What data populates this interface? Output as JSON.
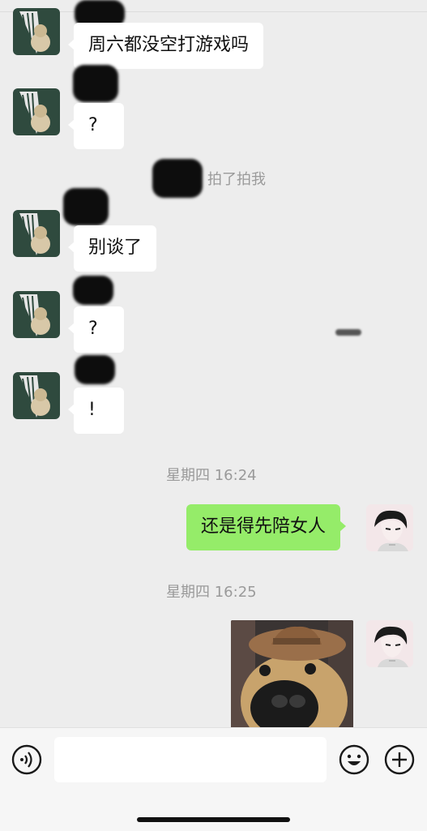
{
  "messages": [
    {
      "text": "周六都没空打游戏吗"
    },
    {
      "text": "?"
    },
    {
      "text": "别谈了"
    },
    {
      "text": "?"
    },
    {
      "text": "!"
    }
  ],
  "pat_notice": {
    "text": "拍了拍我"
  },
  "timestamps": [
    "星期四 16:24",
    "星期四 16:25"
  ],
  "my_message": {
    "text": "还是得先陪女人"
  },
  "colors": {
    "background": "#ededed",
    "my_bubble": "#95ec69",
    "other_bubble": "#ffffff",
    "timestamp_text": "#9a9a9a"
  },
  "icons": {
    "voice": "voice-icon",
    "emoji": "emoji-icon",
    "more": "plus-icon"
  }
}
